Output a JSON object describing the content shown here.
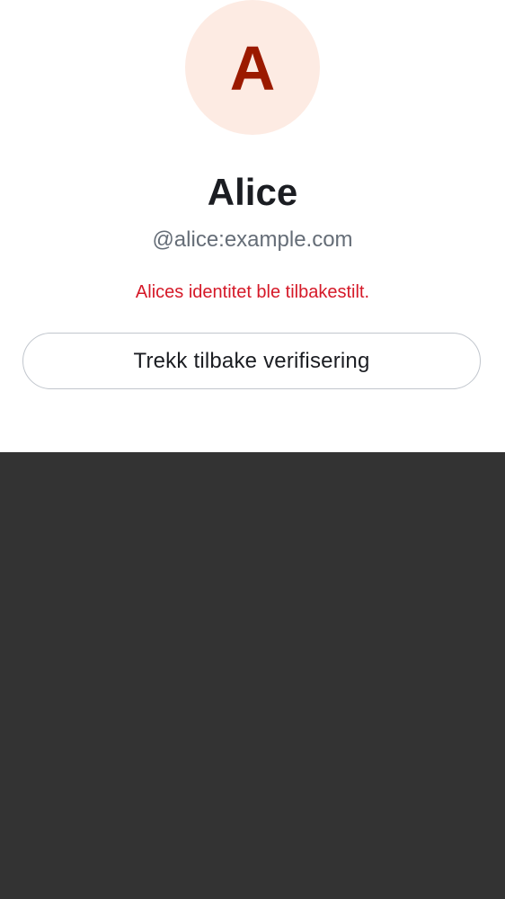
{
  "profile": {
    "avatar_initial": "A",
    "display_name": "Alice",
    "user_id": "@alice:example.com",
    "identity_warning": "Alices identitet ble tilbakestilt.",
    "withdraw_verification_label": "Trekk tilbake verifisering"
  },
  "colors": {
    "avatar_background": "#fdebe3",
    "avatar_letter": "#9b1a00",
    "warning_text": "#d51928",
    "scrim": "#333333"
  }
}
